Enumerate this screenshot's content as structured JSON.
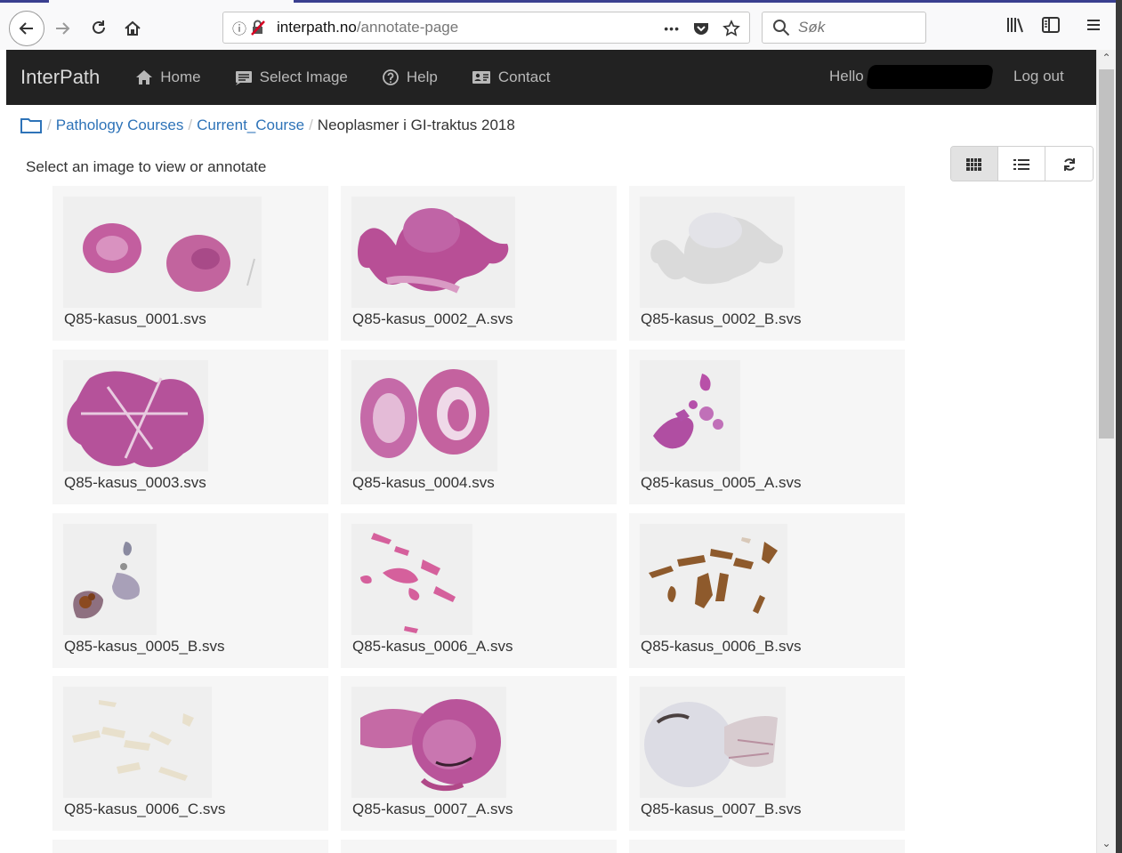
{
  "browser": {
    "url_host": "interpath.no",
    "url_path": "/annotate-page",
    "search_placeholder": "Søk",
    "more_label": "•••"
  },
  "navbar": {
    "brand": "InterPath",
    "links": [
      {
        "label": "Home",
        "icon": "home-icon"
      },
      {
        "label": "Select Image",
        "icon": "select-image-icon"
      },
      {
        "label": "Help",
        "icon": "help-icon"
      },
      {
        "label": "Contact",
        "icon": "contact-icon"
      }
    ],
    "hello": "Hello",
    "logout": "Log out"
  },
  "breadcrumb": {
    "items": [
      "Pathology Courses",
      "Current_Course"
    ],
    "current": "Neoplasmer i GI-traktus 2018",
    "separator": "/"
  },
  "main": {
    "instruction": "Select an image to view or annotate",
    "view_buttons": [
      {
        "name": "grid-view-button",
        "icon": "grid-icon",
        "active": true
      },
      {
        "name": "list-view-button",
        "icon": "list-icon",
        "active": false
      },
      {
        "name": "refresh-button",
        "icon": "refresh-icon",
        "active": false
      }
    ],
    "images": [
      {
        "name": "Q85-kasus_0001.svs",
        "stain": "he"
      },
      {
        "name": "Q85-kasus_0002_A.svs",
        "stain": "he"
      },
      {
        "name": "Q85-kasus_0002_B.svs",
        "stain": "pale"
      },
      {
        "name": "Q85-kasus_0003.svs",
        "stain": "he"
      },
      {
        "name": "Q85-kasus_0004.svs",
        "stain": "he"
      },
      {
        "name": "Q85-kasus_0005_A.svs",
        "stain": "he"
      },
      {
        "name": "Q85-kasus_0005_B.svs",
        "stain": "ihc-mixed"
      },
      {
        "name": "Q85-kasus_0006_A.svs",
        "stain": "he-light"
      },
      {
        "name": "Q85-kasus_0006_B.svs",
        "stain": "ihc-brown"
      },
      {
        "name": "Q85-kasus_0006_C.svs",
        "stain": "beige"
      },
      {
        "name": "Q85-kasus_0007_A.svs",
        "stain": "he"
      },
      {
        "name": "Q85-kasus_0007_B.svs",
        "stain": "pale"
      }
    ]
  },
  "colors": {
    "navbar_bg": "#222222",
    "link": "#2e73b8",
    "he_pink": "#c0569c",
    "ihc_brown": "#8b5a2b"
  }
}
